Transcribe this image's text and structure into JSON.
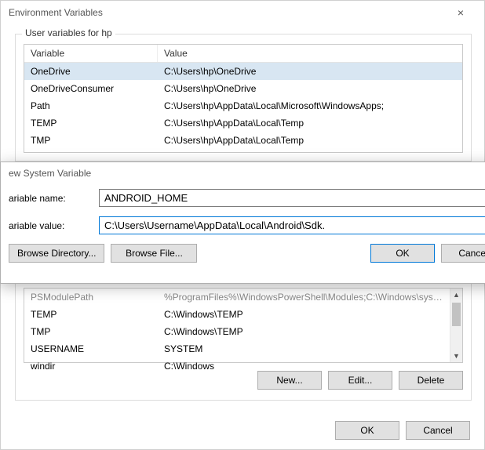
{
  "window": {
    "title": "Environment Variables",
    "close_icon": "×"
  },
  "user_group": {
    "label": "User variables for hp",
    "columns": {
      "name": "Variable",
      "value": "Value"
    },
    "rows": [
      {
        "name": "OneDrive",
        "value": "C:\\Users\\hp\\OneDrive",
        "selected": true
      },
      {
        "name": "OneDriveConsumer",
        "value": "C:\\Users\\hp\\OneDrive"
      },
      {
        "name": "Path",
        "value": "C:\\Users\\hp\\AppData\\Local\\Microsoft\\WindowsApps;"
      },
      {
        "name": "TEMP",
        "value": "C:\\Users\\hp\\AppData\\Local\\Temp"
      },
      {
        "name": "TMP",
        "value": "C:\\Users\\hp\\AppData\\Local\\Temp"
      }
    ]
  },
  "modal": {
    "title": "ew System Variable",
    "chevron": "›",
    "name_label": "ariable name:",
    "value_label": "ariable value:",
    "name_value": "ANDROID_HOME",
    "value_value": "C:\\Users\\Username\\AppData\\Local\\Android\\Sdk.",
    "browse_dir": "Browse Directory...",
    "browse_file": "Browse File...",
    "ok": "OK",
    "cancel": "Cancel"
  },
  "sys_group": {
    "rows": [
      {
        "name": "PSModulePath",
        "value": "%ProgramFiles%\\WindowsPowerShell\\Modules;C:\\Windows\\syste...",
        "dim": true
      },
      {
        "name": "TEMP",
        "value": "C:\\Windows\\TEMP"
      },
      {
        "name": "TMP",
        "value": "C:\\Windows\\TEMP"
      },
      {
        "name": "USERNAME",
        "value": "SYSTEM"
      },
      {
        "name": "windir",
        "value": "C:\\Windows"
      }
    ],
    "buttons": {
      "new": "New...",
      "edit": "Edit...",
      "delete": "Delete"
    }
  },
  "bottom": {
    "ok": "OK",
    "cancel": "Cancel"
  }
}
